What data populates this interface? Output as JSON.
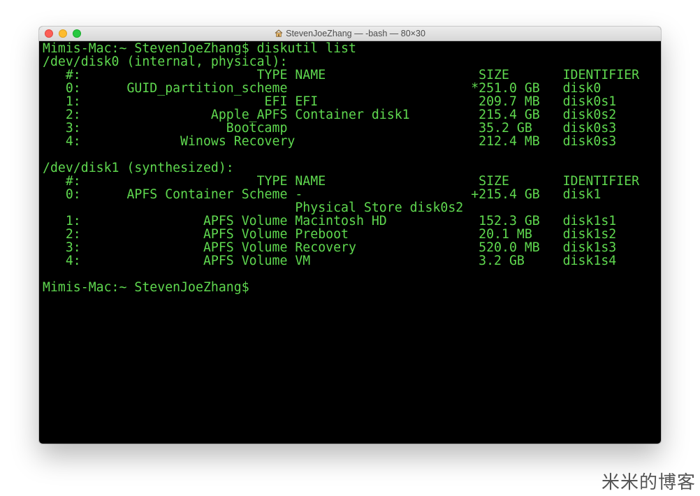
{
  "window": {
    "title": "StevenJoeZhang — -bash — 80×30",
    "title_icon": "home-folder-icon",
    "traffic_lights": {
      "close": "#fd5f57",
      "minimize": "#febc2e",
      "maximize": "#28c840"
    }
  },
  "terminal": {
    "text_color": "#5fd84f",
    "background": "#000000",
    "lines": [
      "Mimis-Mac:~ StevenJoeZhang$ diskutil list",
      "/dev/disk0 (internal, physical):",
      "   #:                       TYPE NAME                    SIZE       IDENTIFIER",
      "   0:      GUID_partition_scheme                        *251.0 GB   disk0",
      "   1:                        EFI EFI                     209.7 MB   disk0s1",
      "   2:                 Apple_APFS Container disk1         215.4 GB   disk0s2",
      "   3:                   Bootcamp                         35.2 GB    disk0s3",
      "   4:             Winows Recovery                        212.4 MB   disk0s3",
      "",
      "/dev/disk1 (synthesized):",
      "   #:                       TYPE NAME                    SIZE       IDENTIFIER",
      "   0:      APFS Container Scheme -                      +215.4 GB   disk1",
      "                                 Physical Store disk0s2",
      "   1:                APFS Volume Macintosh HD            152.3 GB   disk1s1",
      "   2:                APFS Volume Preboot                 20.1 MB    disk1s2",
      "   3:                APFS Volume Recovery                520.0 MB   disk1s3",
      "   4:                APFS Volume VM                      3.2 GB     disk1s4",
      "",
      "Mimis-Mac:~ StevenJoeZhang$"
    ]
  },
  "watermark": "米米的博客"
}
